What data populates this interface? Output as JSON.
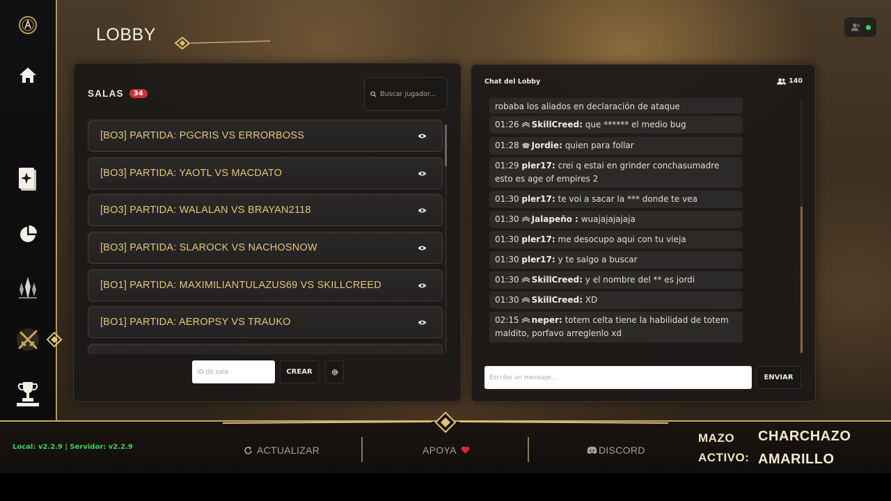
{
  "page": {
    "title": "LOBBY"
  },
  "nav": {
    "items": [
      {
        "name": "home",
        "icon": "home-icon"
      },
      {
        "name": "cards",
        "icon": "cards-icon"
      },
      {
        "name": "stats",
        "icon": "pie-chart-icon"
      },
      {
        "name": "ranked",
        "icon": "crystal-icon"
      },
      {
        "name": "battle",
        "icon": "crossed-swords-icon",
        "active": true
      },
      {
        "name": "trophies",
        "icon": "trophy-icon"
      }
    ]
  },
  "rooms": {
    "label": "SALAS",
    "count": "34",
    "search_placeholder": "Buscar jugador...",
    "items": [
      {
        "name": "[BO3] PARTIDA: PGCRIS VS ERRORBOSS"
      },
      {
        "name": "[BO3] PARTIDA: YAOTL VS MACDATO"
      },
      {
        "name": "[BO3] PARTIDA: WALALAN VS BRAYAN2118"
      },
      {
        "name": "[BO3] PARTIDA: SLAROCK VS NACHOSNOW"
      },
      {
        "name": "[BO1] PARTIDA: MAXIMILIANTULAZUS69 VS SKILLCREED"
      },
      {
        "name": "[BO1] PARTIDA: AEROPSY VS TRAUKO"
      }
    ],
    "room_id_placeholder": "ID de sala",
    "create_label": "CREAR"
  },
  "chat": {
    "title": "Chat del Lobby",
    "online_count": "140",
    "partial_message": "robaba los aliados en declaración de ataque",
    "messages": [
      {
        "time": "01:26",
        "user": "SkillCreed:",
        "text": "que ****** el medio bug",
        "rank": true
      },
      {
        "time": "01:28",
        "user": "Jordie:",
        "text": "quien para follar",
        "rank": true
      },
      {
        "time": "01:29",
        "user": "pler17:",
        "text": "crei q estai en grinder conchasumadre esto es age of empires 2",
        "rank": false
      },
      {
        "time": "01:30",
        "user": "pler17:",
        "text": "te voi a sacar la *** donde te vea",
        "rank": false
      },
      {
        "time": "01:30",
        "user": "Jalapeño :",
        "text": "wuajajajajaja",
        "rank": true
      },
      {
        "time": "01:30",
        "user": "pler17:",
        "text": "me desocupo aqui con tu vieja",
        "rank": false
      },
      {
        "time": "01:30",
        "user": "pler17:",
        "text": "y te salgo a buscar",
        "rank": false
      },
      {
        "time": "01:30",
        "user": "SkillCreed:",
        "text": "y el nombre del ** es jordi",
        "rank": true
      },
      {
        "time": "01:30",
        "user": "SkillCreed:",
        "text": "XD",
        "rank": true
      },
      {
        "time": "02:15",
        "user": "neper:",
        "text": "totem celta tiene la habilidad de totem maldito, porfavo arreglenlo xd",
        "rank": true
      }
    ],
    "input_placeholder": "Escribe un mensaje...",
    "send_label": "ENVIAR"
  },
  "footer": {
    "version": "Local: v2.2.9 | Servidor: v2.2.9",
    "refresh_label": "ACTUALIZAR",
    "support_label": "APOYA",
    "discord_label": "DISCORD",
    "deck_label_1": "MAZO",
    "deck_label_2": "ACTIVO:",
    "deck_name_1": "CHARCHAZO",
    "deck_name_2": "AMARILLO"
  },
  "colors": {
    "accent_gold": "#c9aa62",
    "room_text": "#e4c67a",
    "badge_red": "#c9333b",
    "online_green": "#3fd35a",
    "heart_red": "#e0213a"
  }
}
